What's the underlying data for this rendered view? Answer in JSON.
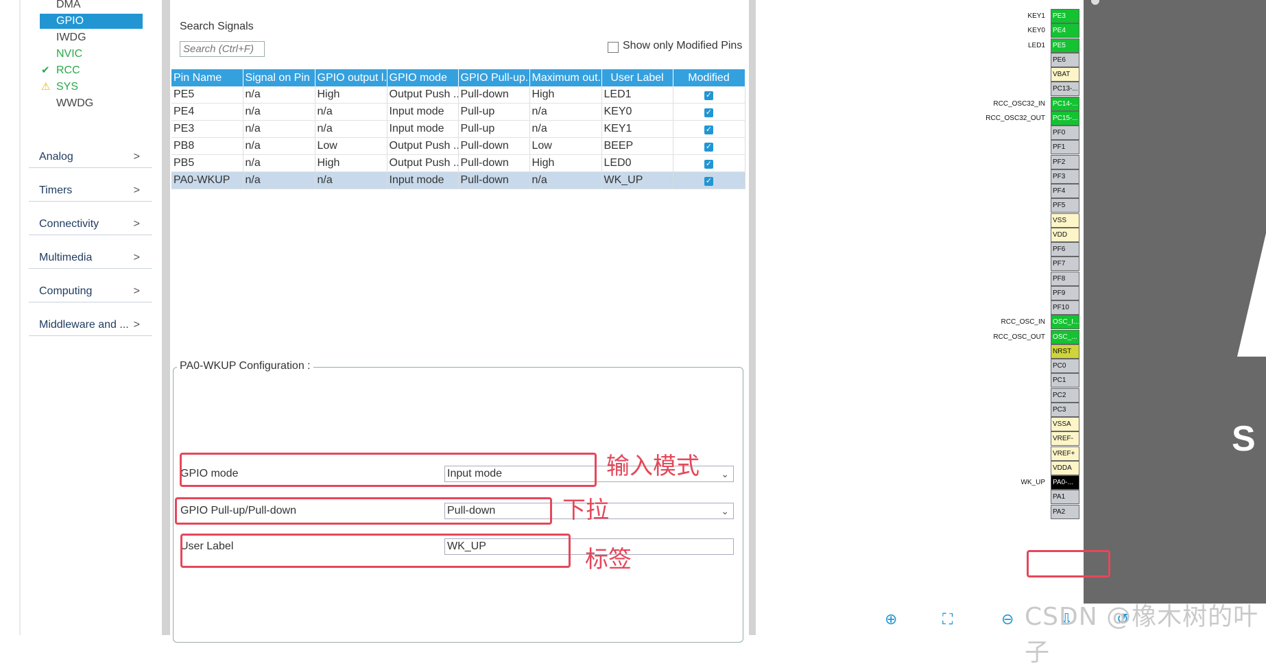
{
  "sidebar": {
    "system_items": [
      {
        "label": "DMA",
        "status": "",
        "style": "gray"
      },
      {
        "label": "GPIO",
        "status": "",
        "style": "sel"
      },
      {
        "label": "IWDG",
        "status": "",
        "style": "gray"
      },
      {
        "label": "NVIC",
        "status": "",
        "style": "green"
      },
      {
        "label": "RCC",
        "status": "✔",
        "style": "green"
      },
      {
        "label": "SYS",
        "status": "⚠",
        "style": "green"
      },
      {
        "label": "WWDG",
        "status": "",
        "style": "gray"
      }
    ],
    "categories": [
      "Analog",
      "Timers",
      "Connectivity",
      "Multimedia",
      "Computing",
      "Middleware and ..."
    ],
    "chevron": ">"
  },
  "search": {
    "label": "Search Signals",
    "placeholder": "Search (Ctrl+F)",
    "show_modified_label": "Show only Modified Pins"
  },
  "table": {
    "columns": [
      "Pin Name",
      "Signal on Pin",
      "GPIO output l...",
      "GPIO mode",
      "GPIO Pull-up...",
      "Maximum out...",
      "User Label",
      "Modified"
    ],
    "rows": [
      [
        "PE5",
        "n/a",
        "High",
        "Output Push ...",
        "Pull-down",
        "High",
        "LED1"
      ],
      [
        "PE4",
        "n/a",
        "n/a",
        "Input mode",
        "Pull-up",
        "n/a",
        "KEY0"
      ],
      [
        "PE3",
        "n/a",
        "n/a",
        "Input mode",
        "Pull-up",
        "n/a",
        "KEY1"
      ],
      [
        "PB8",
        "n/a",
        "Low",
        "Output Push ...",
        "Pull-down",
        "Low",
        "BEEP"
      ],
      [
        "PB5",
        "n/a",
        "High",
        "Output Push ...",
        "Pull-down",
        "High",
        "LED0"
      ],
      [
        "PA0-WKUP",
        "n/a",
        "n/a",
        "Input mode",
        "Pull-down",
        "n/a",
        "WK_UP"
      ]
    ],
    "selected_row": 5
  },
  "config": {
    "title": "PA0-WKUP Configuration :",
    "gpio_mode_label": "GPIO mode",
    "gpio_mode_value": "Input mode",
    "pull_label": "GPIO Pull-up/Pull-down",
    "pull_value": "Pull-down",
    "user_label_label": "User Label",
    "user_label_value": "WK_UP"
  },
  "annotations": {
    "mode": "输入模式",
    "pull": "下拉",
    "label": "标签"
  },
  "chip": {
    "pins": [
      {
        "name": "PE3",
        "color": "green",
        "label": "KEY1"
      },
      {
        "name": "PE4",
        "color": "green",
        "label": "KEY0"
      },
      {
        "name": "PE5",
        "color": "green",
        "label": "LED1"
      },
      {
        "name": "PE6",
        "color": "gray",
        "label": ""
      },
      {
        "name": "VBAT",
        "color": "yellow",
        "label": ""
      },
      {
        "name": "PC13-...",
        "color": "gray",
        "label": ""
      },
      {
        "name": "PC14-...",
        "color": "green",
        "label": "RCC_OSC32_IN"
      },
      {
        "name": "PC15-...",
        "color": "green",
        "label": "RCC_OSC32_OUT"
      },
      {
        "name": "PF0",
        "color": "gray",
        "label": ""
      },
      {
        "name": "PF1",
        "color": "gray",
        "label": ""
      },
      {
        "name": "PF2",
        "color": "gray",
        "label": ""
      },
      {
        "name": "PF3",
        "color": "gray",
        "label": ""
      },
      {
        "name": "PF4",
        "color": "gray",
        "label": ""
      },
      {
        "name": "PF5",
        "color": "gray",
        "label": ""
      },
      {
        "name": "VSS",
        "color": "yellow",
        "label": ""
      },
      {
        "name": "VDD",
        "color": "yellow",
        "label": ""
      },
      {
        "name": "PF6",
        "color": "gray",
        "label": ""
      },
      {
        "name": "PF7",
        "color": "gray",
        "label": ""
      },
      {
        "name": "PF8",
        "color": "gray",
        "label": ""
      },
      {
        "name": "PF9",
        "color": "gray",
        "label": ""
      },
      {
        "name": "PF10",
        "color": "gray",
        "label": ""
      },
      {
        "name": "OSC_I...",
        "color": "green",
        "label": "RCC_OSC_IN"
      },
      {
        "name": "OSC_...",
        "color": "green",
        "label": "RCC_OSC_OUT"
      },
      {
        "name": "NRST",
        "color": "olive",
        "label": ""
      },
      {
        "name": "PC0",
        "color": "gray",
        "label": ""
      },
      {
        "name": "PC1",
        "color": "gray",
        "label": ""
      },
      {
        "name": "PC2",
        "color": "gray",
        "label": ""
      },
      {
        "name": "PC3",
        "color": "gray",
        "label": ""
      },
      {
        "name": "VSSA",
        "color": "yellow",
        "label": ""
      },
      {
        "name": "VREF-",
        "color": "yellow",
        "label": ""
      },
      {
        "name": "VREF+",
        "color": "yellow",
        "label": ""
      },
      {
        "name": "VDDA",
        "color": "yellow",
        "label": ""
      },
      {
        "name": "PA0-...",
        "color": "black",
        "label": "WK_UP"
      },
      {
        "name": "PA1",
        "color": "gray",
        "label": ""
      },
      {
        "name": "PA2",
        "color": "gray",
        "label": ""
      }
    ],
    "logo_text": "S"
  },
  "toolbar_icons": [
    "zoom-in-icon",
    "fit-icon",
    "zoom-out-icon",
    "export-icon",
    "rotate-icon"
  ],
  "watermark": "CSDN @橡木树的叶子",
  "colors": {
    "accent": "#2196d3",
    "header": "#35a0de",
    "annotation": "#e5475a",
    "pin_green": "#14c232"
  }
}
